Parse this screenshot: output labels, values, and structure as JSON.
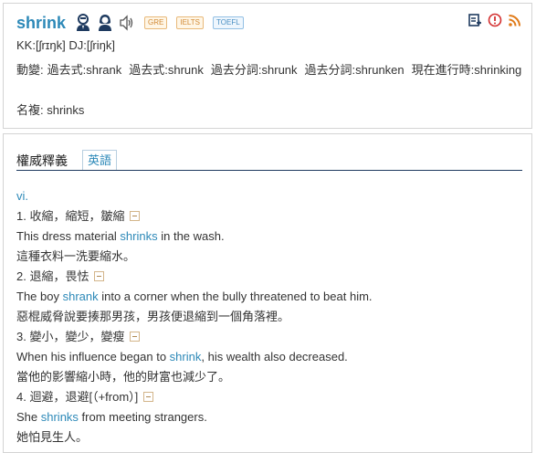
{
  "header": {
    "word": "shrink",
    "tags": [
      "GRE",
      "IELTS",
      "TOEFL"
    ],
    "icons": [
      "male-voice-icon",
      "female-voice-icon",
      "speaker-icon",
      "wordbook-add-icon",
      "alert-icon",
      "rss-icon"
    ],
    "colors": {
      "accent": "#2d89b8",
      "tag": "#d18a35",
      "divider": "#1e3a5f"
    }
  },
  "pronunciation": {
    "kk": "KK:[ʃrɪŋk]",
    "dj": "DJ:[ʃriŋk]"
  },
  "forms": {
    "verb_label": "動變:",
    "items": [
      "過去式:shrank",
      "過去式:shrunk",
      "過去分詞:shrunk",
      "過去分詞:shrunken",
      "現在進行時:shrinking"
    ],
    "plural": "名複: shrinks"
  },
  "tabs": {
    "title": "權威釋義",
    "lang": "英語"
  },
  "definitions": {
    "pos": "vi.",
    "senses": [
      {
        "heading": "1. 收縮，縮短，皺縮",
        "example_before": "This dress material ",
        "example_word": "shrinks",
        "example_after": " in the wash.",
        "translation": "這種衣料一洗要縮水。"
      },
      {
        "heading": "2. 退縮，畏怯",
        "example_before": "The boy ",
        "example_word": "shrank",
        "example_after": " into a corner when the bully threatened to beat him.",
        "translation": "惡棍威脅說要揍那男孩，男孩便退縮到一個角落裡。"
      },
      {
        "heading": "3. 變小，變少，變瘦",
        "example_before": "When his influence began to ",
        "example_word": "shrink",
        "example_after": ", his wealth also decreased.",
        "translation": "當他的影響縮小時，他的財富也減少了。"
      },
      {
        "heading": "4. 迴避，退避[（+from）]",
        "example_before": "She ",
        "example_word": "shrinks",
        "example_after": " from meeting strangers.",
        "translation": "她怕見生人。"
      }
    ]
  }
}
